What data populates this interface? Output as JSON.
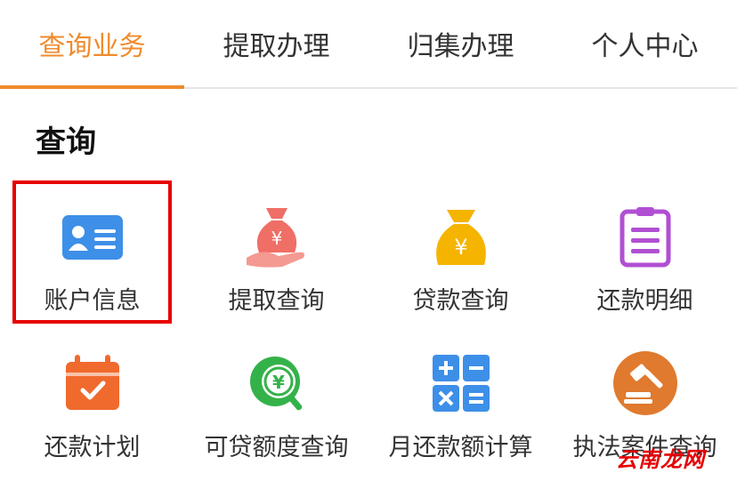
{
  "tabs": [
    {
      "label": "查询业务",
      "active": true
    },
    {
      "label": "提取办理",
      "active": false
    },
    {
      "label": "归集办理",
      "active": false
    },
    {
      "label": "个人中心",
      "active": false
    }
  ],
  "section_title": "查询",
  "tiles": [
    {
      "label": "账户信息",
      "icon": "id-card-icon",
      "color": "#3d8fe8"
    },
    {
      "label": "提取查询",
      "icon": "money-bag-hand-icon",
      "color": "#ef6f66"
    },
    {
      "label": "贷款查询",
      "icon": "money-bag-icon",
      "color": "#f5b400"
    },
    {
      "label": "还款明细",
      "icon": "clipboard-list-icon",
      "color": "#b14fd3"
    },
    {
      "label": "还款计划",
      "icon": "calendar-check-icon",
      "color": "#f06a2d"
    },
    {
      "label": "可贷额度查询",
      "icon": "yuan-search-icon",
      "color": "#34b24a"
    },
    {
      "label": "月还款额计算",
      "icon": "calculator-icon",
      "color": "#3d8fe8"
    },
    {
      "label": "执法案件查询",
      "icon": "gavel-icon",
      "color": "#e07a2e"
    }
  ],
  "watermark": "云南龙网"
}
